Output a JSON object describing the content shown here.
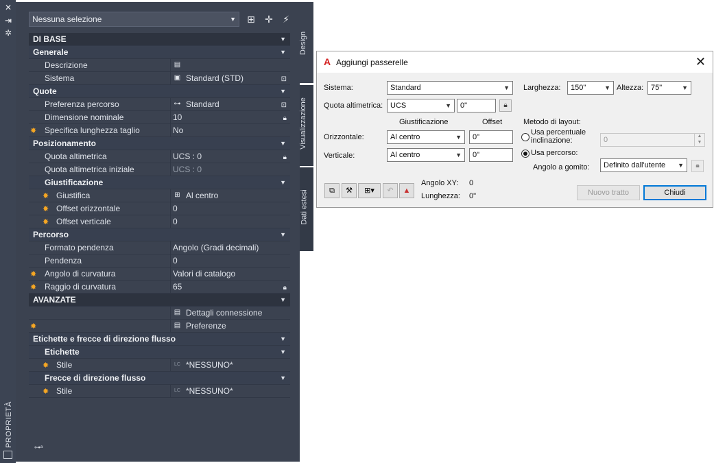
{
  "palette": {
    "side_label": "PROPRIETÀ",
    "selection": "Nessuna selezione",
    "tabs": {
      "design": "Design",
      "visualizzazione": "Visualizzazione",
      "dati_estesi": "Dati estesi"
    },
    "sections": {
      "di_base": "DI BASE",
      "generale": "Generale",
      "quote": "Quote",
      "posizionamento": "Posizionamento",
      "giustificazione": "Giustificazione",
      "percorso": "Percorso",
      "avanzate": "AVANZATE",
      "etichette_frecce": "Etichette e frecce di direzione flusso",
      "etichette": "Etichette",
      "frecce": "Frecce di direzione flusso"
    },
    "rows": {
      "descrizione": {
        "name": "Descrizione",
        "value": ""
      },
      "sistema": {
        "name": "Sistema",
        "value": "Standard (STD)"
      },
      "preferenza": {
        "name": "Preferenza percorso",
        "value": "Standard"
      },
      "dimensione": {
        "name": "Dimensione nominale",
        "value": "10"
      },
      "specifica": {
        "name": "Specifica lunghezza taglio",
        "value": "No"
      },
      "quota": {
        "name": "Quota altimetrica",
        "value": "UCS : 0"
      },
      "quota_iniziale": {
        "name": "Quota altimetrica iniziale",
        "value": "UCS : 0"
      },
      "giustifica": {
        "name": "Giustifica",
        "value": "Al centro"
      },
      "offset_orizz": {
        "name": "Offset orizzontale",
        "value": "0"
      },
      "offset_vert": {
        "name": "Offset verticale",
        "value": "0"
      },
      "formato": {
        "name": "Formato pendenza",
        "value": "Angolo (Gradi decimali)"
      },
      "pendenza": {
        "name": "Pendenza",
        "value": "0"
      },
      "angolo": {
        "name": "Angolo di curvatura",
        "value": "Valori di catalogo"
      },
      "raggio": {
        "name": "Raggio di curvatura",
        "value": "65"
      },
      "dettagli": {
        "value": "Dettagli connessione"
      },
      "preferenze": {
        "value": "Preferenze"
      },
      "stile1": {
        "name": "Stile",
        "value": "*NESSUNO*"
      },
      "stile2": {
        "name": "Stile",
        "value": "*NESSUNO*"
      }
    }
  },
  "dialog": {
    "title": "Aggiungi passerelle",
    "sistema_label": "Sistema:",
    "sistema_value": "Standard",
    "quota_label": "Quota altimetrica:",
    "quota_value": "UCS",
    "quota_offset": "0\"",
    "giustificazione_header": "Giustificazione",
    "offset_header": "Offset",
    "orizzontale_label": "Orizzontale:",
    "orizzontale_value": "Al centro",
    "orizzontale_offset": "0\"",
    "verticale_label": "Verticale:",
    "verticale_value": "Al centro",
    "verticale_offset": "0\"",
    "larghezza_label": "Larghezza:",
    "larghezza_value": "150\"",
    "altezza_label": "Altezza:",
    "altezza_value": "75\"",
    "metodo_label": "Metodo di layout:",
    "radio1_line1": "Usa percentuale",
    "radio1_line2": "inclinazione:",
    "radio1_value": "0",
    "radio2": "Usa percorso:",
    "gomito_label": "Angolo a gomito:",
    "gomito_value": "Definito dall'utente",
    "angolo_xy_label": "Angolo XY:",
    "angolo_xy_value": "0",
    "lunghezza_label": "Lunghezza:",
    "lunghezza_value": "0\"",
    "nuovo_tratto": "Nuovo tratto",
    "chiudi": "Chiudi"
  }
}
